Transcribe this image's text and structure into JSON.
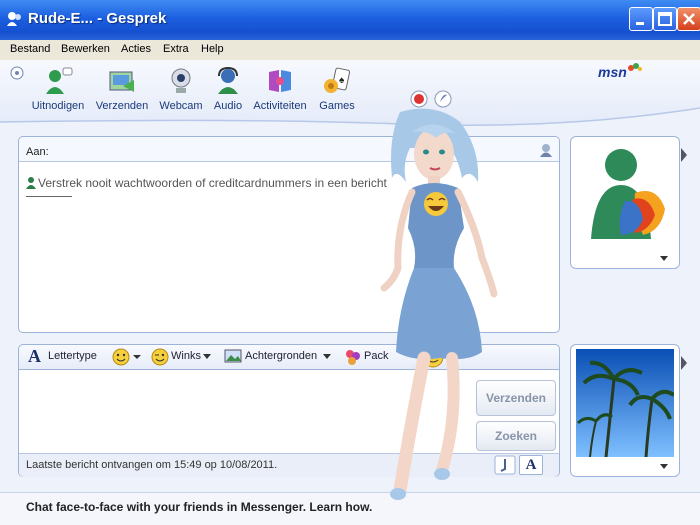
{
  "window": {
    "title": "Rude-E... - Gesprek",
    "controls": [
      "minimize",
      "maximize",
      "close"
    ]
  },
  "menu": [
    "Bestand",
    "Bewerken",
    "Acties",
    "Extra",
    "Help"
  ],
  "toolbar": {
    "items": [
      {
        "label": "Uitnodigen",
        "icon": "invite-icon"
      },
      {
        "label": "Verzenden",
        "icon": "send-file-icon"
      },
      {
        "label": "Webcam",
        "icon": "webcam-icon"
      },
      {
        "label": "Audio",
        "icon": "audio-icon"
      },
      {
        "label": "Activiteiten",
        "icon": "activities-icon"
      },
      {
        "label": "Games",
        "icon": "games-icon"
      }
    ],
    "logo": "msn"
  },
  "conversation": {
    "to_label": "Aan:",
    "warning": "Verstrek nooit wachtwoorden of creditcardnummers in een bericht"
  },
  "compose": {
    "format": [
      {
        "label": "Lettertype",
        "icon": "font-icon"
      },
      {
        "label": "",
        "icon": "emoticon-icon"
      },
      {
        "label": "Winks",
        "icon": "winks-icon"
      },
      {
        "label": "Achtergronden",
        "icon": "backgrounds-icon"
      },
      {
        "label": "Pack",
        "icon": "pack-icon"
      }
    ],
    "send_label": "Verzenden",
    "search_label": "Zoeken"
  },
  "status": "Laatste bericht ontvangen om 15:49 op 10/08/2011.",
  "bottom_banner": "Chat face-to-face with your friends in Messenger. Learn how."
}
